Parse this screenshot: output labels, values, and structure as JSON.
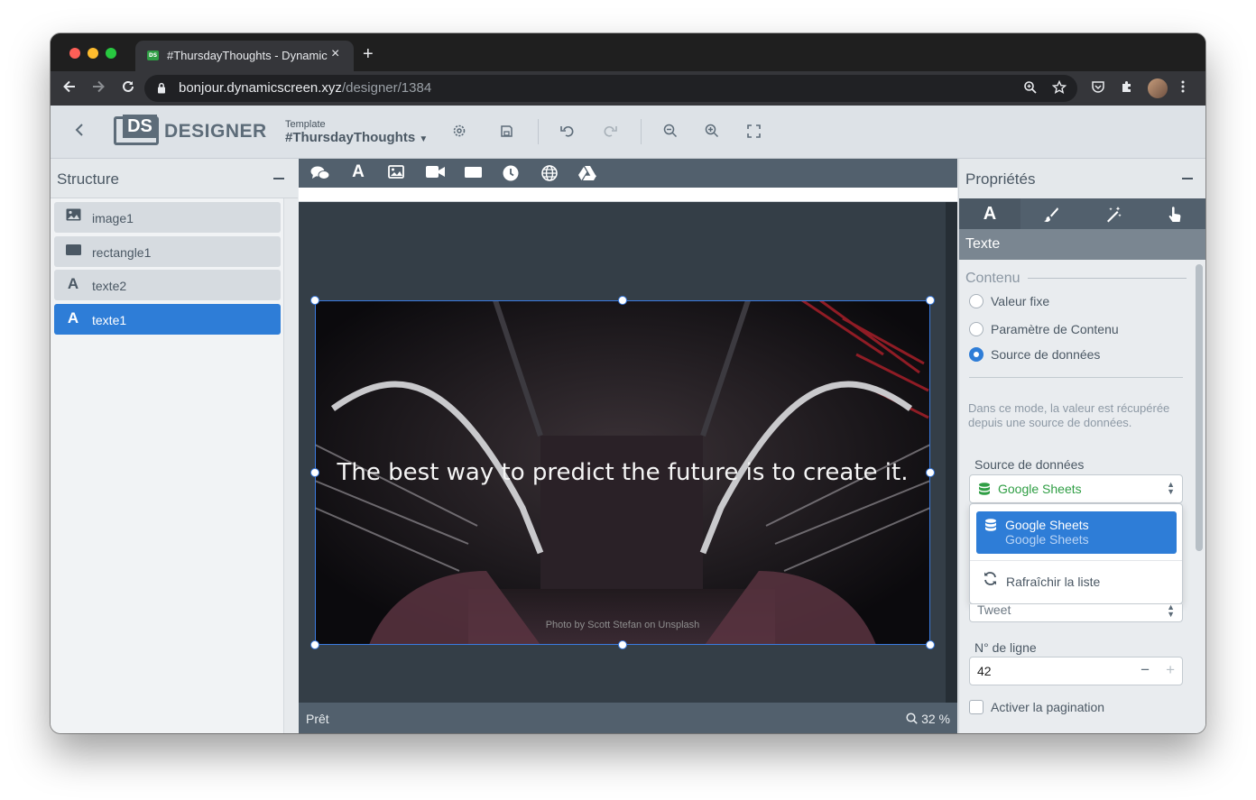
{
  "browser": {
    "tab_title": "#ThursdayThoughts - Dynamic",
    "tab_favicon": "DS",
    "url_host": "bonjour.dynamicscreen.xyz",
    "url_path": "/designer/1384",
    "icons": [
      "back-arrow-icon",
      "forward-arrow-icon",
      "reload-icon",
      "lock-icon",
      "zoom-icon",
      "star-icon",
      "pocket-icon",
      "extensions-icon",
      "profile-avatar",
      "kebab-menu-icon"
    ]
  },
  "header": {
    "logo_box": "DS",
    "logo_text": "DESIGNER",
    "template_label": "Template",
    "template_name": "#ThursdayThoughts",
    "icons": [
      "back-chevron-icon",
      "settings-gear-icon",
      "save-icon",
      "undo-icon",
      "redo-icon",
      "zoom-out-icon",
      "zoom-in-icon",
      "fullscreen-icon"
    ]
  },
  "structure": {
    "title": "Structure",
    "items": [
      {
        "label": "image1",
        "icon": "image-icon"
      },
      {
        "label": "rectangle1",
        "icon": "rectangle-icon"
      },
      {
        "label": "texte2",
        "icon": "text-icon"
      },
      {
        "label": "texte1",
        "icon": "text-icon",
        "selected": true
      }
    ]
  },
  "canvas": {
    "toolbar_icons": [
      "comments-icon",
      "text-icon",
      "image-icon",
      "video-icon",
      "rectangle-icon",
      "clock-icon",
      "globe-icon",
      "drive-icon"
    ],
    "quote": "The best way to predict the future is to create it.",
    "credit": "Photo by Scott Stefan on Unsplash",
    "status": "Prêt",
    "zoom": "32 %"
  },
  "properties": {
    "title": "Propriétés",
    "tabs": [
      "text-tab-icon",
      "brush-tab-icon",
      "magic-wand-tab-icon",
      "pointer-tab-icon"
    ],
    "section": "Texte",
    "contenu_legend": "Contenu",
    "radios": [
      {
        "label": "Valeur fixe",
        "checked": false
      },
      {
        "label": "Paramètre de Contenu",
        "checked": false
      },
      {
        "label": "Source de données",
        "checked": true
      }
    ],
    "help": "Dans ce mode, la valeur est récupérée depuis une source de données.",
    "source_label": "Source de données",
    "source_value": "Google Sheets",
    "dropdown_option_title": "Google Sheets",
    "dropdown_option_subtitle": "Google Sheets",
    "dropdown_refresh": "Rafraîchir la liste",
    "column_value": "Tweet",
    "row_label": "N° de ligne",
    "row_value": "42",
    "pagination_label": "Activer la pagination",
    "accent_color": "#2e7dd7",
    "sheet_color": "#2f9e44"
  }
}
